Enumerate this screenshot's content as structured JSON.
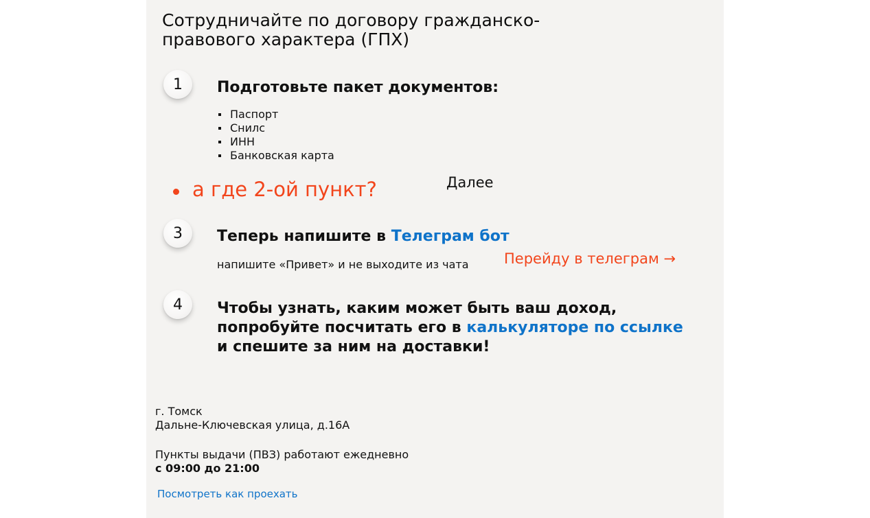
{
  "title": "Сотрудничайте по договору гражданско-правового характера (ГПХ)",
  "steps": {
    "s1": {
      "number": "1",
      "heading": "Подготовьте пакет документов:",
      "documents": [
        "Паспорт",
        "Снилс",
        "ИНН",
        "Банковская карта"
      ]
    },
    "s3": {
      "number": "3",
      "heading_prefix": "Теперь напишите в ",
      "heading_link": "Телеграм бот",
      "subtext": "напишите «Привет» и не выходите из чата",
      "action_link": "Перейду в телеграм →"
    },
    "s4": {
      "number": "4",
      "text_before": "Чтобы узнать, каким может быть ваш доход, попробуйте посчитать его в ",
      "link": "калькуляторе по ссылке",
      "text_after": " и спешите за ним на доставки!"
    }
  },
  "question": "а где 2-ой пункт?",
  "next_label": "Далее",
  "footer": {
    "city": "г. Томск",
    "address": "Дальне-Ключевская улица, д.16А",
    "schedule": "Пункты выдачи (ПВЗ) работают ежедневно",
    "hours": "с 09:00 до 21:00",
    "route_link": "Посмотреть как проехать"
  },
  "colors": {
    "accent_orange": "#f2451c",
    "link_blue": "#0f73c9",
    "card_bg": "#f4f3f1"
  }
}
